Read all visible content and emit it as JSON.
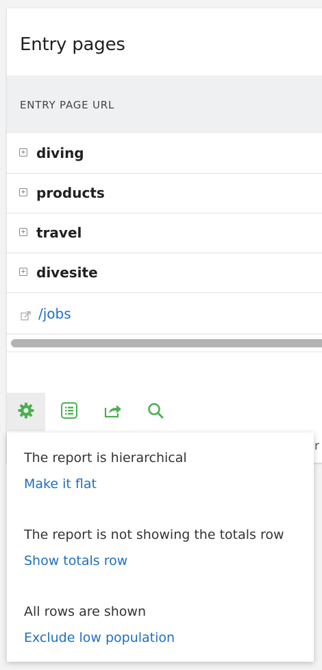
{
  "report": {
    "title": "Entry pages",
    "column_header": "ENTRY PAGE URL",
    "rows": [
      {
        "label": "diving",
        "type": "folder"
      },
      {
        "label": "products",
        "type": "folder"
      },
      {
        "label": "travel",
        "type": "folder"
      },
      {
        "label": "divesite",
        "type": "folder"
      },
      {
        "label": "/jobs",
        "type": "link"
      }
    ]
  },
  "toolbar": {
    "icons": [
      "gear-icon",
      "list-icon",
      "export-icon",
      "search-icon"
    ],
    "active": "gear-icon",
    "accent_color": "#4caf50"
  },
  "popup": {
    "hierarchical_text": "The report is hierarchical",
    "make_flat_link": "Make it flat",
    "totals_text": "The report is not showing the totals row",
    "show_totals_link": "Show totals row",
    "rows_text": "All rows are shown",
    "exclude_low_link": "Exclude low population"
  },
  "edge_glyph": "r",
  "colors": {
    "link": "#1e6fc2",
    "header_bg": "#eef0f2"
  }
}
